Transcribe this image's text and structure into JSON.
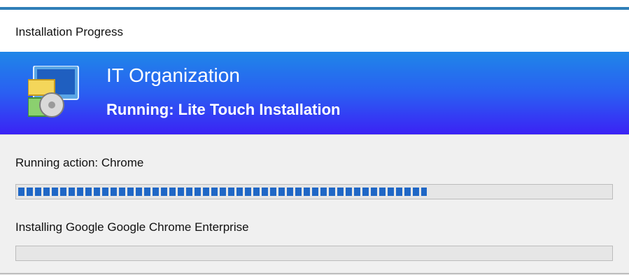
{
  "window": {
    "title": "Installation Progress"
  },
  "banner": {
    "organization": "IT Organization",
    "status": "Running: Lite Touch Installation",
    "icon": "installer-computer-icon"
  },
  "progress": {
    "action_label": "Running action: Chrome",
    "overall_percent": 69,
    "detail_label": "Installing Google Google Chrome Enterprise",
    "detail_percent": 0
  },
  "colors": {
    "accent": "#2f7fb8",
    "banner_top": "#1f86e8",
    "banner_bottom": "#3b22f5",
    "progress_fill": "#1f67c6",
    "panel_bg": "#f0f0f0"
  }
}
